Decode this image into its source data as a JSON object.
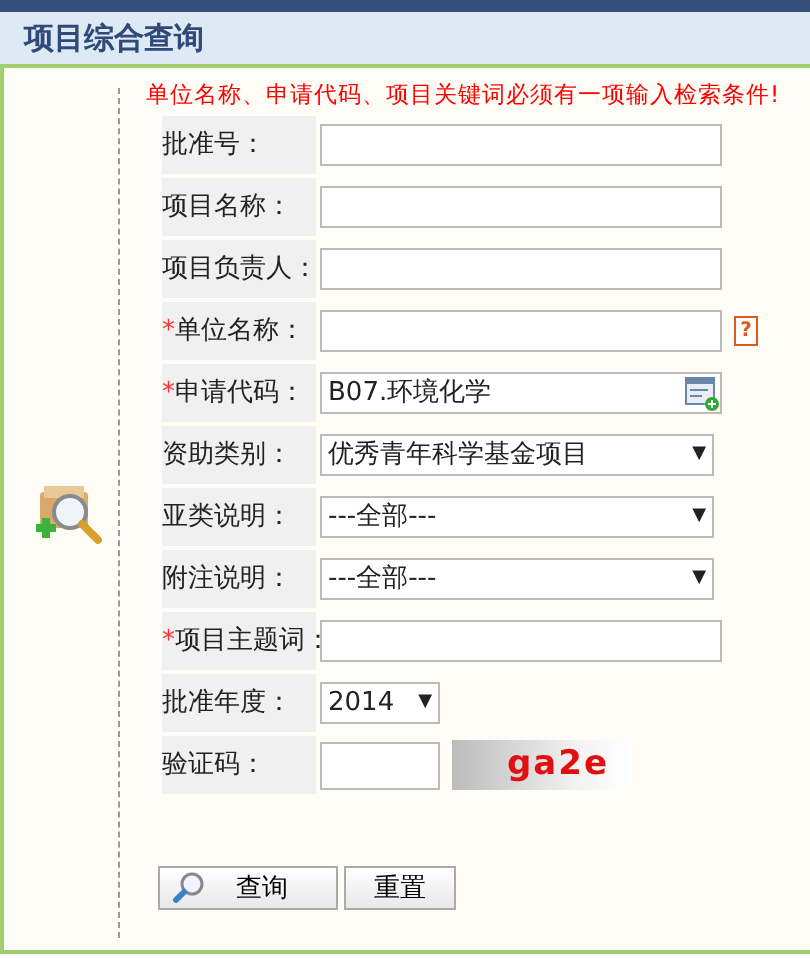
{
  "title": "项目综合查询",
  "notice": "单位名称、申请代码、项目关键词必须有一项输入检索条件!",
  "fields": [
    {
      "kind": "text",
      "label": "批准号："
    },
    {
      "kind": "text",
      "label": "项目名称："
    },
    {
      "kind": "text",
      "label": "项目负责人："
    },
    {
      "kind": "text",
      "label": "单位名称：",
      "required_mark": "*",
      "help_glyph": "?"
    },
    {
      "kind": "code",
      "label": "申请代码：",
      "required_mark": "*",
      "value": "B07.环境化学"
    },
    {
      "kind": "select",
      "label": "资助类别：",
      "value": "优秀青年科学基金项目",
      "arrow": "▼"
    },
    {
      "kind": "select",
      "label": "亚类说明：",
      "value": "---全部---",
      "arrow": "▼"
    },
    {
      "kind": "select",
      "label": "附注说明：",
      "value": "---全部---",
      "arrow": "▼"
    },
    {
      "kind": "text",
      "label": "项目主题词：",
      "required_mark": "*"
    },
    {
      "kind": "short_select",
      "label": "批准年度：",
      "value": "2014",
      "arrow": "▼"
    },
    {
      "kind": "captcha",
      "label": "验证码：",
      "captcha": "ga2e"
    }
  ],
  "buttons": [
    {
      "label": "查询",
      "icon": true
    },
    {
      "label": "重置",
      "icon": false
    }
  ]
}
